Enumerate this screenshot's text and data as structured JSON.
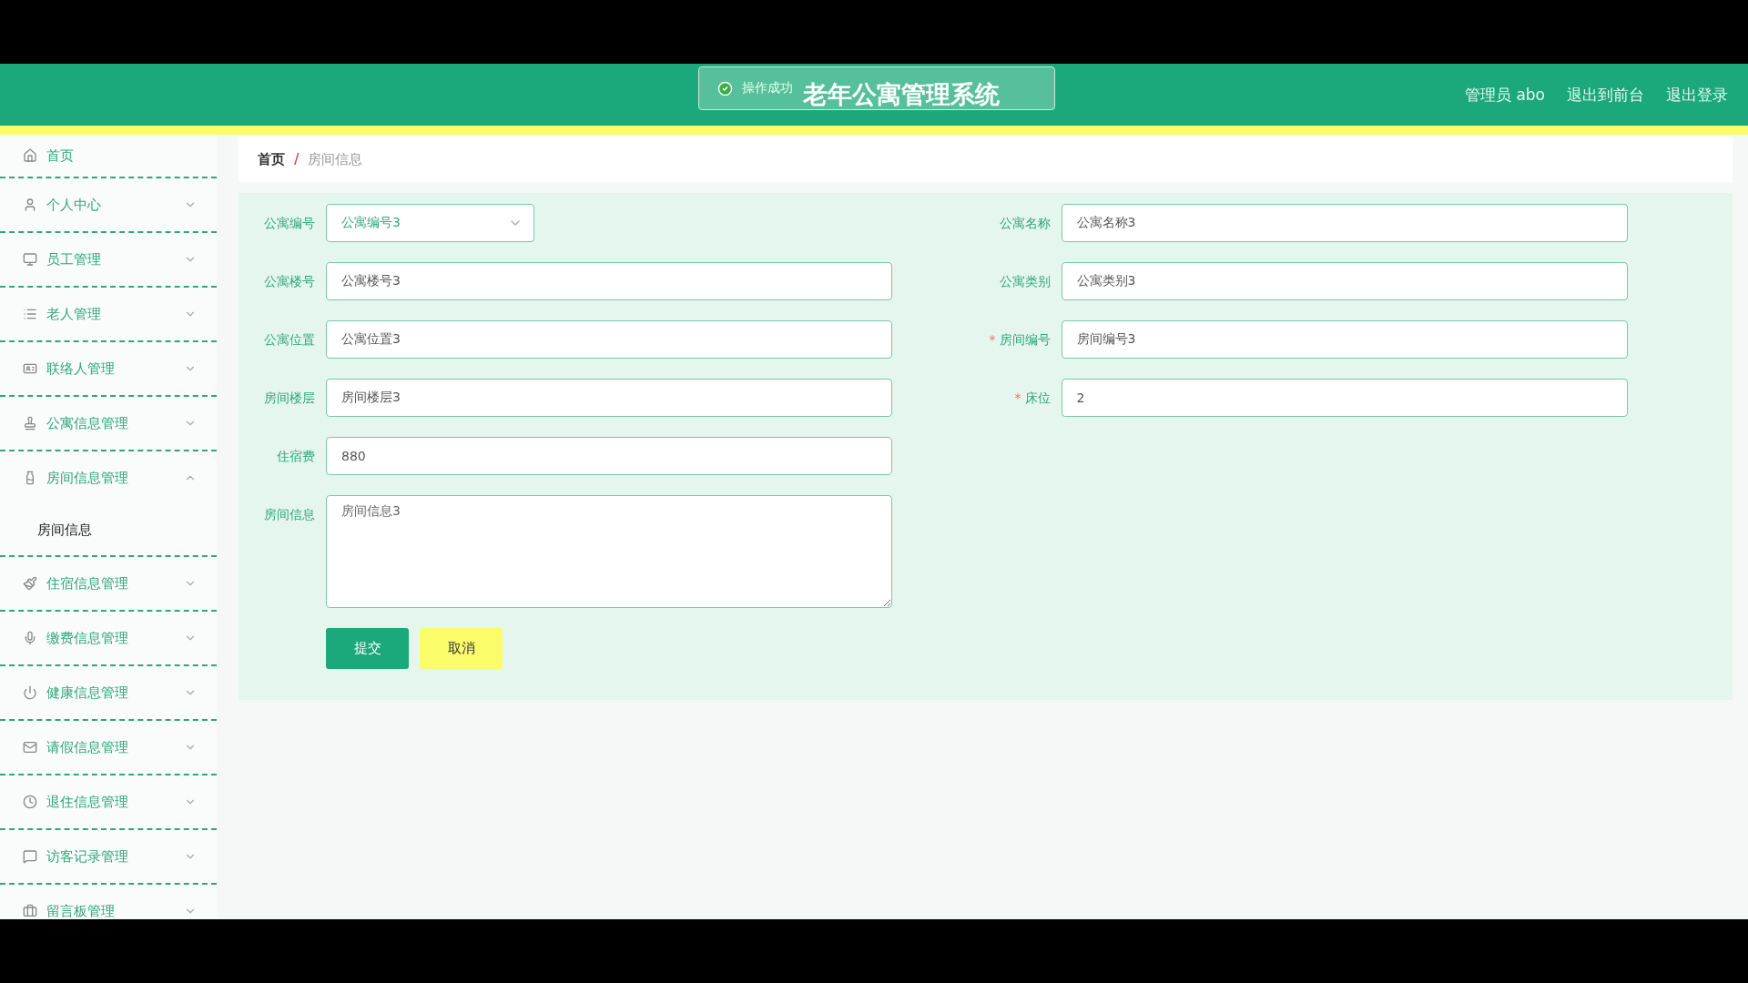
{
  "header": {
    "title": "老年公寓管理系统",
    "user": "管理员 abo",
    "links": [
      "退出到前台",
      "退出登录"
    ]
  },
  "toast": {
    "kind": "success",
    "text": "操作成功"
  },
  "sidebar": {
    "items": [
      {
        "label": "首页",
        "kind": "link",
        "expanded": false
      },
      {
        "label": "个人中心",
        "kind": "menu",
        "expanded": false
      },
      {
        "label": "员工管理",
        "kind": "menu",
        "expanded": false
      },
      {
        "label": "老人管理",
        "kind": "menu",
        "expanded": false
      },
      {
        "label": "联络人管理",
        "kind": "menu",
        "expanded": false
      },
      {
        "label": "公寓信息管理",
        "kind": "menu",
        "expanded": false
      },
      {
        "label": "房间信息管理",
        "kind": "menu",
        "expanded": true,
        "children": [
          {
            "label": "房间信息"
          }
        ]
      },
      {
        "label": "住宿信息管理",
        "kind": "menu",
        "expanded": false
      },
      {
        "label": "缴费信息管理",
        "kind": "menu",
        "expanded": false
      },
      {
        "label": "健康信息管理",
        "kind": "menu",
        "expanded": false
      },
      {
        "label": "请假信息管理",
        "kind": "menu",
        "expanded": false
      },
      {
        "label": "退住信息管理",
        "kind": "menu",
        "expanded": false
      },
      {
        "label": "访客记录管理",
        "kind": "menu",
        "expanded": false
      },
      {
        "label": "留言板管理",
        "kind": "menu",
        "expanded": false
      }
    ]
  },
  "breadcrumb": {
    "items": [
      "首页",
      "房间信息"
    ],
    "separator": "/"
  },
  "form": {
    "required_mark": "*",
    "left": [
      {
        "label": "公寓编号",
        "kind": "select",
        "value": "公寓编号3",
        "required": false
      },
      {
        "label": "公寓楼号",
        "kind": "input",
        "value": "公寓楼号3",
        "required": false
      },
      {
        "label": "公寓位置",
        "kind": "input",
        "value": "公寓位置3",
        "required": false
      },
      {
        "label": "房间楼层",
        "kind": "input",
        "value": "房间楼层3",
        "required": false
      },
      {
        "label": "住宿费",
        "kind": "input",
        "value": "880",
        "required": false
      },
      {
        "label": "房间信息",
        "kind": "textarea",
        "value": "房间信息3",
        "required": false
      }
    ],
    "right": [
      {
        "label": "公寓名称",
        "kind": "input",
        "value": "公寓名称3",
        "required": false
      },
      {
        "label": "公寓类别",
        "kind": "input",
        "value": "公寓类别3",
        "required": false
      },
      {
        "label": "房间编号",
        "kind": "input",
        "value": "房间编号3",
        "required": true
      },
      {
        "label": "床位",
        "kind": "input",
        "value": "2",
        "required": true
      }
    ],
    "buttons": [
      {
        "label": "提交",
        "kind": "primary"
      },
      {
        "label": "取消",
        "kind": "secondary"
      }
    ]
  }
}
